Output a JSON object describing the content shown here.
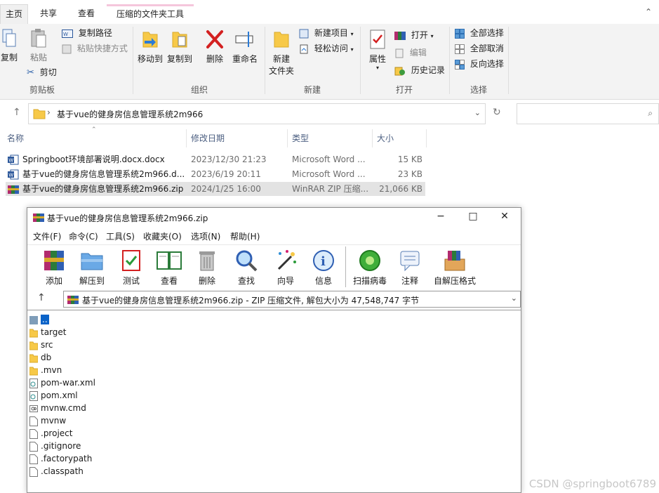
{
  "ribbon_tabs": [
    "主页",
    "共享",
    "查看",
    "压缩的文件夹工具"
  ],
  "ribbon": {
    "clipboard": {
      "copy": "复制",
      "paste": "粘贴",
      "copy_path": "复制路径",
      "paste_shortcut": "粘贴快捷方式",
      "cut": "剪切",
      "group": "剪贴板"
    },
    "organize": {
      "move_to": "移动到",
      "copy_to": "复制到",
      "delete": "删除",
      "rename": "重命名",
      "group": "组织"
    },
    "new": {
      "new_folder_line1": "新建",
      "new_folder_line2": "文件夹",
      "new_item": "新建项目",
      "easy_access": "轻松访问",
      "group": "新建"
    },
    "open": {
      "properties": "属性",
      "open": "打开",
      "edit": "编辑",
      "history": "历史记录",
      "group": "打开"
    },
    "select": {
      "select_all": "全部选择",
      "select_none": "全部取消",
      "invert": "反向选择",
      "group": "选择"
    }
  },
  "address": {
    "path": "基于vue的健身房信息管理系统2m966"
  },
  "columns": [
    "名称",
    "修改日期",
    "类型",
    "大小"
  ],
  "files": [
    {
      "name": "Springboot环境部署说明.docx.docx",
      "date": "2023/12/30 21:23",
      "type": "Microsoft Word ...",
      "size": "15 KB",
      "icon": "word-icon"
    },
    {
      "name": "基于vue的健身房信息管理系统2m966.d...",
      "date": "2023/6/19 20:11",
      "type": "Microsoft Word ...",
      "size": "23 KB",
      "icon": "word-icon"
    },
    {
      "name": "基于vue的健身房信息管理系统2m966.zip",
      "date": "2024/1/25 16:00",
      "type": "WinRAR ZIP 压缩...",
      "size": "21,066 KB",
      "icon": "winrar-icon"
    }
  ],
  "winrar": {
    "title": "基于vue的健身房信息管理系统2m966.zip",
    "menu": [
      "文件(F)",
      "命令(C)",
      "工具(S)",
      "收藏夹(O)",
      "选项(N)",
      "帮助(H)"
    ],
    "tools": [
      "添加",
      "解压到",
      "测试",
      "查看",
      "删除",
      "查找",
      "向导",
      "信息",
      "扫描病毒",
      "注释",
      "自解压格式"
    ],
    "path": "基于vue的健身房信息管理系统2m966.zip - ZIP 压缩文件, 解包大小为 47,548,747 字节",
    "items": [
      {
        "name": "..",
        "kind": "up"
      },
      {
        "name": "target",
        "kind": "folder"
      },
      {
        "name": "src",
        "kind": "folder"
      },
      {
        "name": "db",
        "kind": "folder"
      },
      {
        "name": ".mvn",
        "kind": "folder"
      },
      {
        "name": "pom-war.xml",
        "kind": "xml"
      },
      {
        "name": "pom.xml",
        "kind": "xml"
      },
      {
        "name": "mvnw.cmd",
        "kind": "cmd"
      },
      {
        "name": "mvnw",
        "kind": "file"
      },
      {
        "name": ".project",
        "kind": "file"
      },
      {
        "name": ".gitignore",
        "kind": "file"
      },
      {
        "name": ".factorypath",
        "kind": "file"
      },
      {
        "name": ".classpath",
        "kind": "file"
      }
    ]
  },
  "watermark": "CSDN @springboot6789",
  "colors": {
    "ribbon_bg": "#f3f3f3",
    "selection": "#e3e3e3",
    "folder": "#f7c948",
    "header_text": "#4d6082",
    "delete_red": "#d32020"
  }
}
